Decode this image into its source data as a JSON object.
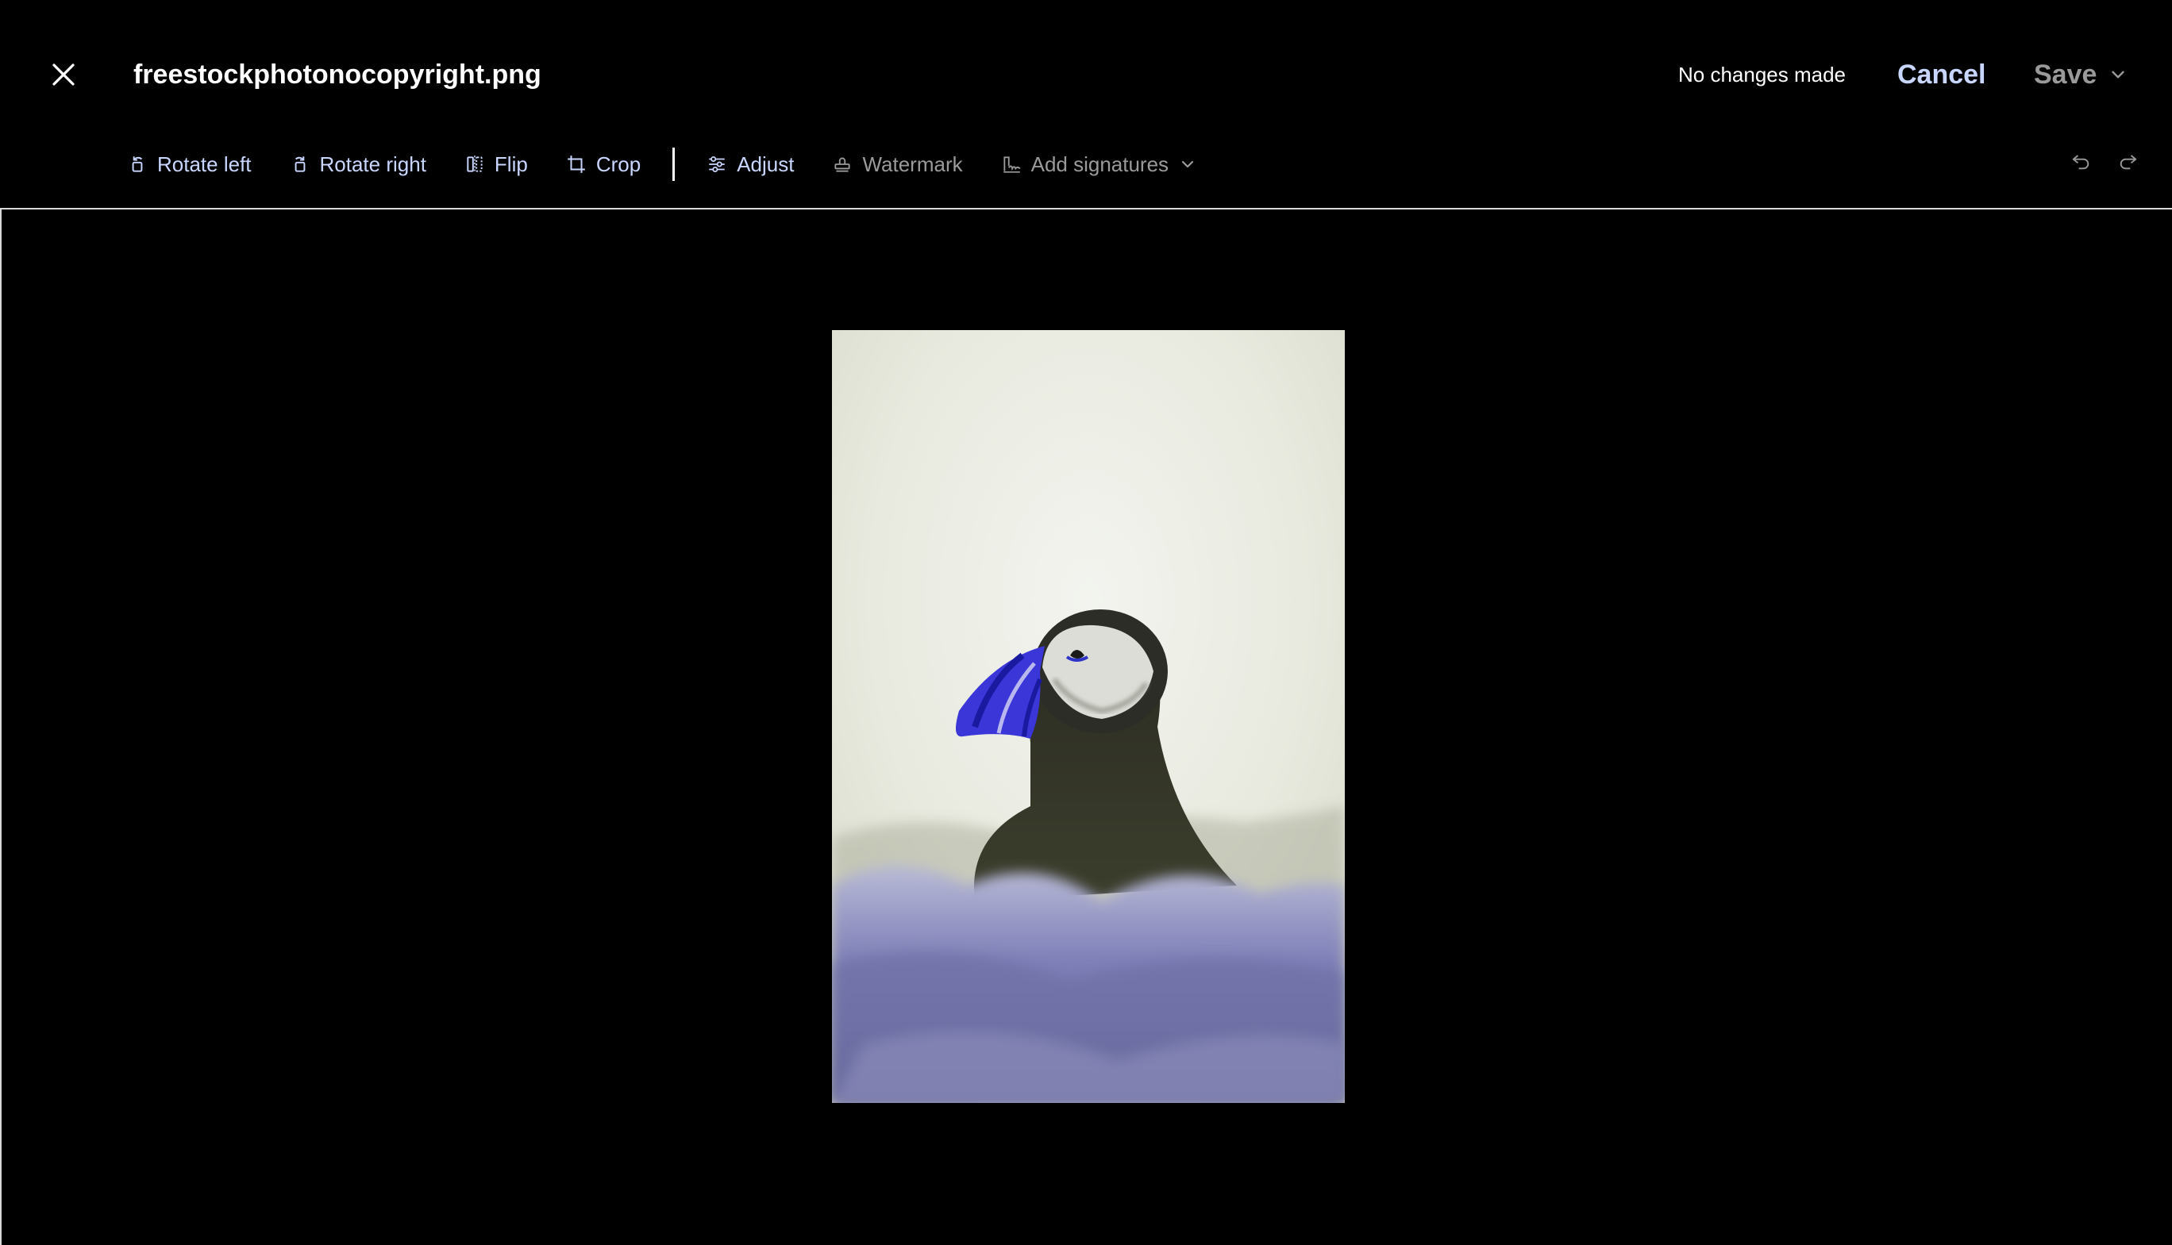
{
  "header": {
    "file_name": "freestockphotonocopyright.png",
    "status": "No changes made",
    "cancel_label": "Cancel",
    "save_label": "Save"
  },
  "toolbar": {
    "rotate_left": "Rotate left",
    "rotate_right": "Rotate right",
    "flip": "Flip",
    "crop": "Crop",
    "adjust": "Adjust",
    "watermark": "Watermark",
    "add_signatures": "Add signatures"
  },
  "icons": {
    "close": "close-icon",
    "save_menu": "chevron-down-icon",
    "rotate_left": "rotate-left-icon",
    "rotate_right": "rotate-right-icon",
    "flip": "flip-icon",
    "crop": "crop-icon",
    "adjust": "sliders-icon",
    "watermark": "stamp-icon",
    "add_signatures": "signature-icon",
    "undo": "undo-icon",
    "redo": "redo-icon"
  },
  "colors": {
    "background": "#000000",
    "accent_text": "#c9d6ff",
    "disabled_text": "#9a9a9a",
    "canvas_border": "#d9d9d9"
  }
}
